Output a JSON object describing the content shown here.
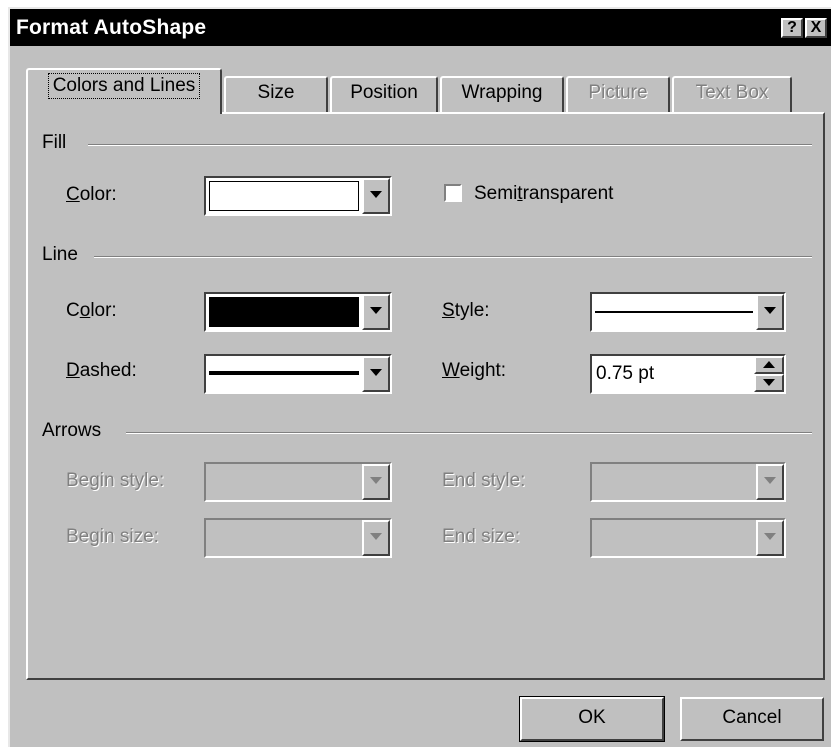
{
  "window": {
    "title": "Format AutoShape",
    "help_glyph": "?",
    "close_glyph": "X"
  },
  "tabs": [
    {
      "label": "Colors and Lines",
      "state": "active"
    },
    {
      "label": "Size",
      "state": "enabled"
    },
    {
      "label": "Position",
      "state": "enabled"
    },
    {
      "label": "Wrapping",
      "state": "enabled"
    },
    {
      "label": "Picture",
      "state": "disabled"
    },
    {
      "label": "Text Box",
      "state": "disabled"
    }
  ],
  "fill": {
    "section_label": "Fill",
    "color_label": "Color:",
    "color_value": "#ffffff",
    "semitransparent_label": "Semitransparent",
    "semitransparent_checked": false
  },
  "line": {
    "section_label": "Line",
    "color_label": "Color:",
    "color_value": "#000000",
    "style_label": "Style:",
    "dashed_label": "Dashed:",
    "weight_label": "Weight:",
    "weight_value": "0.75 pt"
  },
  "arrows": {
    "section_label": "Arrows",
    "begin_style_label": "Begin style:",
    "end_style_label": "End style:",
    "begin_size_label": "Begin size:",
    "end_size_label": "End size:"
  },
  "buttons": {
    "ok": "OK",
    "cancel": "Cancel"
  }
}
